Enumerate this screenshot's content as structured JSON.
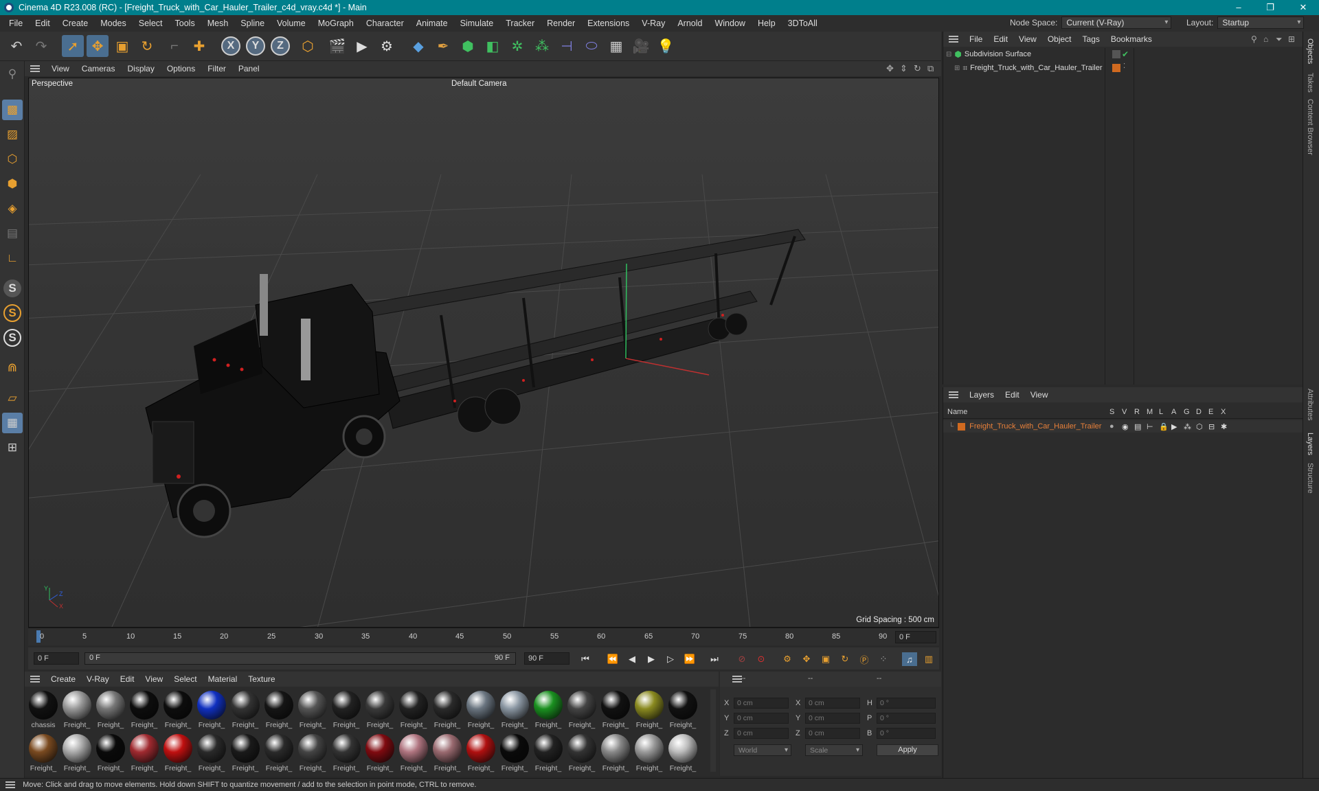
{
  "window": {
    "title": "Cinema 4D R23.008 (RC) - [Freight_Truck_with_Car_Hauler_Trailer_c4d_vray.c4d *] - Main",
    "minimize": "–",
    "restore": "❐",
    "close": "✕"
  },
  "menubar": {
    "items": [
      "File",
      "Edit",
      "Create",
      "Modes",
      "Select",
      "Tools",
      "Mesh",
      "Spline",
      "Volume",
      "MoGraph",
      "Character",
      "Animate",
      "Simulate",
      "Tracker",
      "Render",
      "Extensions",
      "V-Ray",
      "Arnold",
      "Window",
      "Help",
      "3DToAll"
    ],
    "node_space_label": "Node Space:",
    "node_space_value": "Current (V-Ray)",
    "layout_label": "Layout:",
    "layout_value": "Startup"
  },
  "toolbar": {
    "axis_x": "X",
    "axis_y": "Y",
    "axis_z": "Z"
  },
  "left_tools": {
    "s1": "S",
    "s2": "S",
    "s3": "S"
  },
  "viewport": {
    "menu": [
      "View",
      "Cameras",
      "Display",
      "Options",
      "Filter",
      "Panel"
    ],
    "view_name": "Perspective",
    "camera": "Default Camera",
    "grid_spacing": "Grid Spacing : 500 cm",
    "axis_y": "Y",
    "axis_z": "Z",
    "axis_x": "X"
  },
  "timeline": {
    "ticks": [
      "0",
      "5",
      "10",
      "15",
      "20",
      "25",
      "30",
      "35",
      "40",
      "45",
      "50",
      "55",
      "60",
      "65",
      "70",
      "75",
      "80",
      "85",
      "90"
    ],
    "current_frame": "0 F",
    "start_field": "0 F",
    "range_start": "0 F",
    "range_end": "90 F",
    "end_field": "90 F"
  },
  "materials": {
    "menu": [
      "Create",
      "V-Ray",
      "Edit",
      "View",
      "Select",
      "Material",
      "Texture"
    ],
    "row1": [
      {
        "label": "chassis",
        "color": "#111"
      },
      {
        "label": "Freight_",
        "color": "#999"
      },
      {
        "label": "Freight_",
        "color": "#777"
      },
      {
        "label": "Freight_",
        "color": "#0d0d0d"
      },
      {
        "label": "Freight_",
        "color": "#0d0d0d"
      },
      {
        "label": "Freight_",
        "color": "#1030c0"
      },
      {
        "label": "Freight_",
        "color": "#333"
      },
      {
        "label": "Freight_",
        "color": "#151515"
      },
      {
        "label": "Freight_",
        "color": "#555"
      },
      {
        "label": "Freight_",
        "color": "#222"
      },
      {
        "label": "Freight_",
        "color": "#3a3a3a"
      },
      {
        "label": "Freight_",
        "color": "#222"
      },
      {
        "label": "Freight_",
        "color": "#2a2a2a"
      },
      {
        "label": "Freight_",
        "color": "#6a7580"
      },
      {
        "label": "Freight_",
        "color": "#8a96a2"
      },
      {
        "label": "Freight_",
        "color": "#1a9020"
      },
      {
        "label": "Freight_",
        "color": "#444"
      },
      {
        "label": "Freight_",
        "color": "#111"
      },
      {
        "label": "Freight_",
        "color": "#8a8a20"
      },
      {
        "label": "Freight_",
        "color": "#111"
      }
    ],
    "row2": [
      {
        "label": "Freight_",
        "color": "#7a4a20"
      },
      {
        "label": "Freight_",
        "color": "#aaa"
      },
      {
        "label": "Freight_",
        "color": "#0a0a0a"
      },
      {
        "label": "Freight_",
        "color": "#a02a30"
      },
      {
        "label": "Freight_",
        "color": "#c01010"
      },
      {
        "label": "Freight_",
        "color": "#2a2a2a"
      },
      {
        "label": "Freight_",
        "color": "#1a1a1a"
      },
      {
        "label": "Freight_",
        "color": "#2a2a2a"
      },
      {
        "label": "Freight_",
        "color": "#444"
      },
      {
        "label": "Freight_",
        "color": "#333"
      },
      {
        "label": "Freight_",
        "color": "#800a10"
      },
      {
        "label": "Freight_",
        "color": "#b07580"
      },
      {
        "label": "Freight_",
        "color": "#9a6a70"
      },
      {
        "label": "Freight_",
        "color": "#b01010"
      },
      {
        "label": "Freight_",
        "color": "#0a0a0a"
      },
      {
        "label": "Freight_",
        "color": "#222"
      },
      {
        "label": "Freight_",
        "color": "#333"
      },
      {
        "label": "Freight_",
        "color": "#888"
      },
      {
        "label": "Freight_",
        "color": "#999"
      },
      {
        "label": "Freight_",
        "color": "#bbb"
      }
    ]
  },
  "coordinates": {
    "header": [
      "--",
      "--",
      "--"
    ],
    "rows": [
      {
        "a": "X",
        "av": "0 cm",
        "b": "X",
        "bv": "0 cm",
        "c": "H",
        "cv": "0 °"
      },
      {
        "a": "Y",
        "av": "0 cm",
        "b": "Y",
        "bv": "0 cm",
        "c": "P",
        "cv": "0 °"
      },
      {
        "a": "Z",
        "av": "0 cm",
        "b": "Z",
        "bv": "0 cm",
        "c": "B",
        "cv": "0 °"
      }
    ],
    "mode": "World",
    "scale": "Scale",
    "apply": "Apply"
  },
  "objects": {
    "menu": [
      "File",
      "Edit",
      "View",
      "Object",
      "Tags",
      "Bookmarks"
    ],
    "items": [
      {
        "name": "Subdivision Surface"
      },
      {
        "name": "Freight_Truck_with_Car_Hauler_Trailer"
      }
    ]
  },
  "layers": {
    "menu": [
      "Layers",
      "Edit",
      "View"
    ],
    "columns": [
      "Name",
      "S",
      "V",
      "R",
      "M",
      "L",
      "A",
      "G",
      "D",
      "E",
      "X"
    ],
    "row": "Freight_Truck_with_Car_Hauler_Trailer"
  },
  "right_tabs": [
    "Objects",
    "Takes",
    "Content Browser",
    "Attributes",
    "Layers",
    "Structure"
  ],
  "status": "Move: Click and drag to move elements. Hold down SHIFT to quantize movement / add to the selection in point mode, CTRL to remove."
}
